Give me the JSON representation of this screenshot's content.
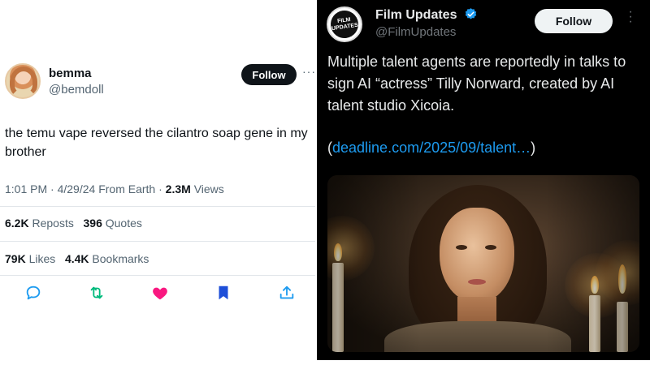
{
  "left_tweet": {
    "display_name": "bemma",
    "handle": "@bemdoll",
    "follow_label": "Follow",
    "more_label": "···",
    "text": "the temu vape reversed the cilantro soap gene in my brother",
    "time": "1:01 PM",
    "date": "4/29/24",
    "source": "From Earth",
    "views_count": "2.3M",
    "views_label": "Views",
    "reposts_count": "6.2K",
    "reposts_label": "Reposts",
    "quotes_count": "396",
    "quotes_label": "Quotes",
    "likes_count": "79K",
    "likes_label": "Likes",
    "bookmarks_count": "4.4K",
    "bookmarks_label": "Bookmarks",
    "action_icons": [
      "reply-icon",
      "repost-icon",
      "like-icon",
      "bookmark-icon",
      "share-icon"
    ],
    "colors": {
      "like": "#f91880",
      "bookmark": "#1d4ed8",
      "reply": "#1d9bf0",
      "repost": "#00ba7c"
    }
  },
  "right_tweet": {
    "display_name": "Film Updates",
    "handle": "@FilmUpdates",
    "avatar_text": "FILM UPDATES",
    "follow_label": "Follow",
    "text": "Multiple talent agents are reportedly in talks to sign AI “actress” Tilly Norward, created by AI talent studio Xicoia.",
    "link_open": "(",
    "link_text": "deadline.com/2025/09/talent…",
    "link_close": ")",
    "colors": {
      "link": "#1d9bf0",
      "verified": "#1d9bf0",
      "background": "#000000"
    }
  }
}
